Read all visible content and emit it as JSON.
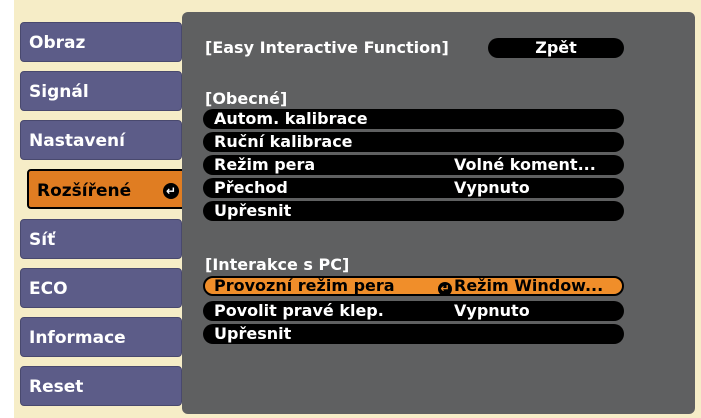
{
  "sidebar": {
    "items": [
      {
        "label": "Obraz"
      },
      {
        "label": "Signál"
      },
      {
        "label": "Nastavení"
      },
      {
        "label": "Rozšířené"
      },
      {
        "label": "Síť"
      },
      {
        "label": "ECO"
      },
      {
        "label": "Informace"
      },
      {
        "label": "Reset"
      }
    ],
    "active_index": 3,
    "enter_icon_glyph": "↵"
  },
  "panel": {
    "title": "[Easy Interactive Function]",
    "back_button": "Zpět",
    "general": {
      "heading": "[Obecné]",
      "rows": [
        {
          "label": "Autom. kalibrace",
          "value": ""
        },
        {
          "label": "Ruční kalibrace",
          "value": ""
        },
        {
          "label": "Režim pera",
          "value": "Volné koment..."
        },
        {
          "label": "Přechod",
          "value": "Vypnuto"
        },
        {
          "label": "Upřesnit",
          "value": ""
        }
      ]
    },
    "pc": {
      "heading": "[Interakce s PC]",
      "rows": [
        {
          "label": "Provozní režim pera",
          "value": "Režim Window..."
        },
        {
          "label": "Povolit pravé klep.",
          "value": "Vypnuto"
        },
        {
          "label": "Upřesnit",
          "value": ""
        }
      ],
      "selected_index": 0
    }
  },
  "colors": {
    "frame_background": "#f6edc7",
    "sidebar_item": "#5c5c88",
    "sidebar_active": "#e07d22",
    "panel_background": "#5f6061",
    "row_background": "#000000",
    "row_selected": "#f08e2a"
  },
  "icons": {
    "enter": "enter-icon"
  }
}
